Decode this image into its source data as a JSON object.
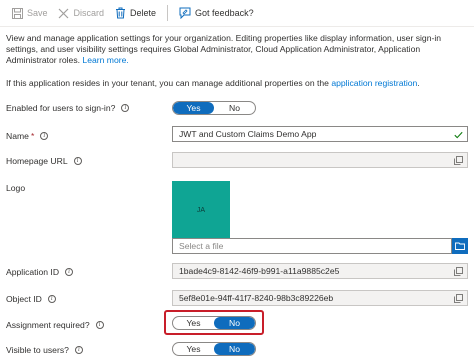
{
  "toolbar": {
    "save_label": "Save",
    "discard_label": "Discard",
    "delete_label": "Delete",
    "feedback_label": "Got feedback?"
  },
  "description": {
    "text": "View and manage application settings for your organization. Editing properties like display information, user sign-in settings, and user visibility settings requires Global Administrator, Cloud Application Administrator, Application Administrator roles. ",
    "learn_more": "Learn more.",
    "tenant_text": "If this application resides in your tenant, you can manage additional properties on the ",
    "app_registration_link": "application registration",
    "tenant_end": "."
  },
  "fields": {
    "enabled_label": "Enabled for users to sign-in?",
    "enabled_yes": "Yes",
    "enabled_no": "No",
    "enabled_selected": "Yes",
    "name_label": "Name",
    "name_required": "*",
    "name_value": "JWT and Custom Claims Demo App",
    "homepage_label": "Homepage URL",
    "homepage_value": "",
    "logo_label": "Logo",
    "logo_initials": "JA",
    "select_file_placeholder": "Select a file",
    "app_id_label": "Application ID",
    "app_id_value": "1bade4c9-8142-46f9-b991-a11a9885c2e5",
    "object_id_label": "Object ID",
    "object_id_value": "5ef8e01e-94ff-41f7-8240-98b3c89226eb",
    "assignment_label": "Assignment required?",
    "assignment_yes": "Yes",
    "assignment_no": "No",
    "assignment_selected": "No",
    "visible_label": "Visible to users?",
    "visible_yes": "Yes",
    "visible_no": "No",
    "visible_selected": "No"
  },
  "colors": {
    "accent": "#0f6cbd",
    "link": "#0078d4",
    "logo_bg": "#0fa594",
    "highlight": "#c81e2a",
    "valid_check": "#107c10"
  }
}
